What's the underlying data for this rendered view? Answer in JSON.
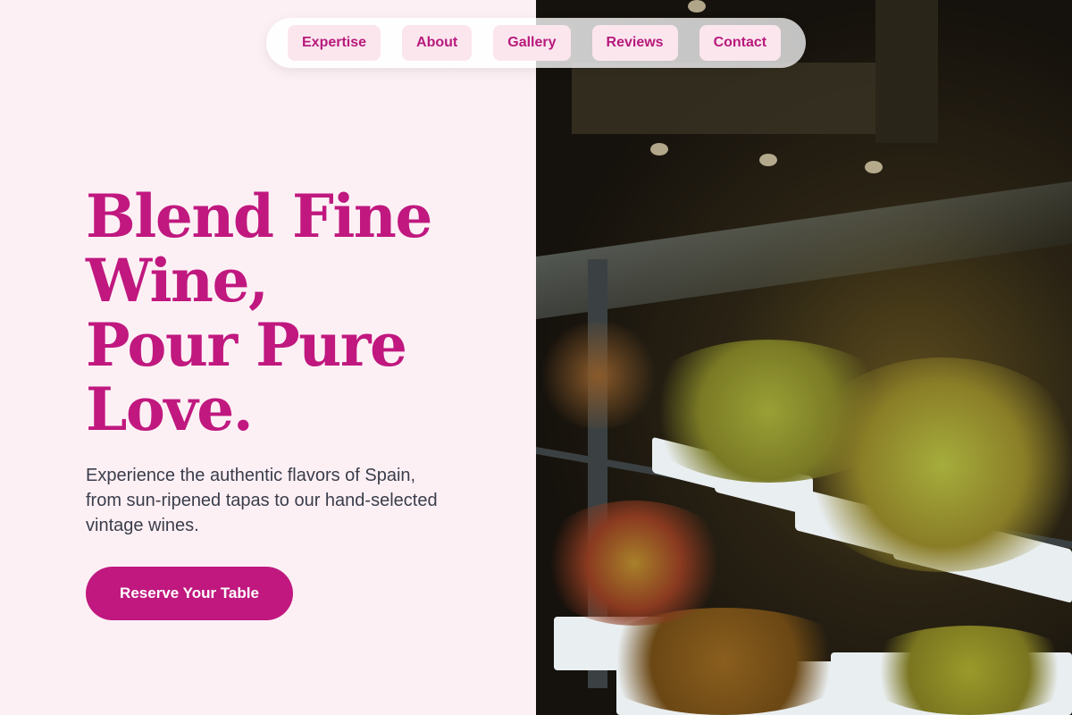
{
  "nav": {
    "items": [
      "Expertise",
      "About",
      "Gallery",
      "Reviews",
      "Contact"
    ]
  },
  "hero": {
    "headline_lines": [
      "Blend Fine",
      "Wine,",
      "Pour Pure",
      "Love."
    ],
    "subtitle": "Experience the authentic flavors of Spain, from sun-ripened tapas to our hand-selected vintage wines.",
    "cta_label": "Reserve Your Table"
  },
  "colors": {
    "accent": "#c0187f",
    "background": "#fdf0f5",
    "nav_chip": "#fbe6ee",
    "body_text": "#3a3d4a"
  },
  "image": {
    "subject": "olive-display-case-photo"
  }
}
